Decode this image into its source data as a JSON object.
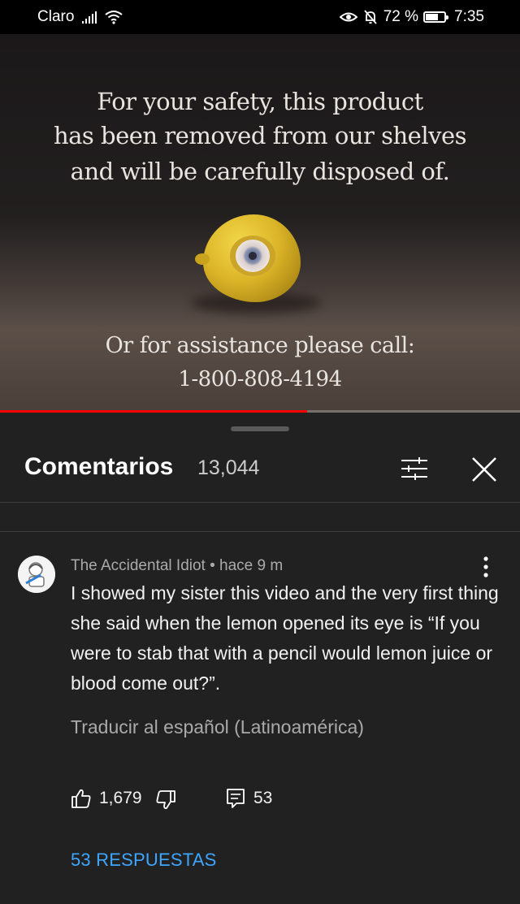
{
  "status_bar": {
    "carrier": "Claro",
    "battery": "72 %",
    "battery_fraction": 0.72,
    "time": "7:35"
  },
  "video": {
    "caption_lines": [
      "For your safety, this product",
      "has been removed from our shelves",
      "and will be carefully disposed of."
    ],
    "assistance_text": "Or for assistance please call:",
    "phone": "1-800-808-4194",
    "progress_fraction": 0.59
  },
  "comments_panel": {
    "title": "Comentarios",
    "count": "13,044"
  },
  "comment": {
    "author": "The Accidental Idiot",
    "separator": "•",
    "time": "hace 9 m",
    "text": "I showed my sister this video and the very first thing she said when the lemon opened its eye is “If you were to stab that with a pencil would lemon juice or blood come out?”.",
    "translate_label": "Traducir al español (Latinoamérica)",
    "likes": "1,679",
    "reply_count": "53",
    "replies_label": "53 RESPUESTAS"
  },
  "icons": {
    "signal": "signal-icon",
    "wifi": "wifi-icon",
    "eye": "eye-comfort-icon",
    "mute": "bell-off-icon",
    "battery": "battery-icon",
    "filter": "sort-filter-icon",
    "close": "close-icon",
    "menu": "more-vertical-icon",
    "like": "thumb-up-icon",
    "dislike": "thumb-down-icon",
    "reply": "reply-comment-icon"
  },
  "colors": {
    "accent": "#3ea6ff",
    "progress": "#ff0000",
    "sheet": "#212121"
  }
}
